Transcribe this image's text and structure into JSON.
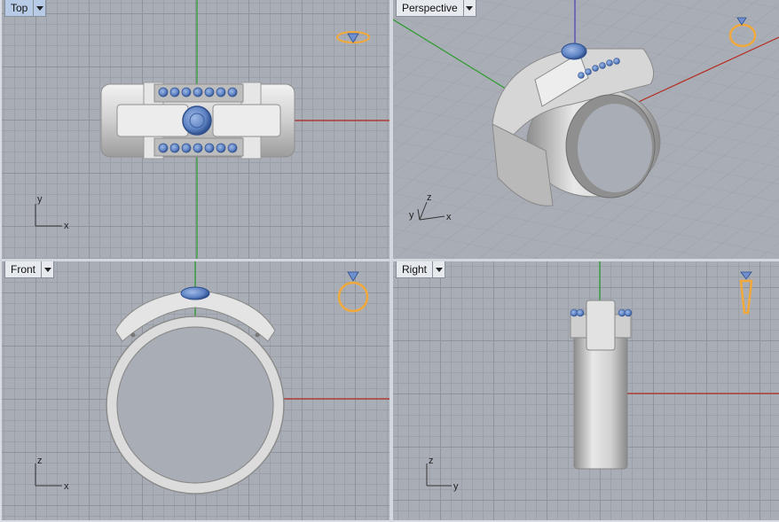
{
  "viewports": {
    "top": {
      "label": "Top",
      "axis_labels": [
        "y",
        "x"
      ],
      "active": true
    },
    "perspective": {
      "label": "Perspective",
      "axis_labels": [
        "y",
        "z",
        "x"
      ],
      "active": false
    },
    "front": {
      "label": "Front",
      "axis_labels": [
        "z",
        "x"
      ],
      "active": false
    },
    "right": {
      "label": "Right",
      "axis_labels": [
        "z",
        "y"
      ],
      "active": false
    }
  },
  "colors": {
    "viewport_bg": "#a9aeb6",
    "active_tab": "#b7cbe6",
    "axis_x": "#b52a1f",
    "axis_y": "#2b9a2b",
    "axis_z": "#4a3fb0",
    "metal": "#dcdcdc",
    "gem": "#5d82c2",
    "ring_icon": "#f2a93b"
  },
  "icons": [
    "ring-top-view-icon",
    "ring-perspective-icon",
    "ring-front-view-icon",
    "ring-side-view-icon",
    "chevron-down-icon"
  ]
}
